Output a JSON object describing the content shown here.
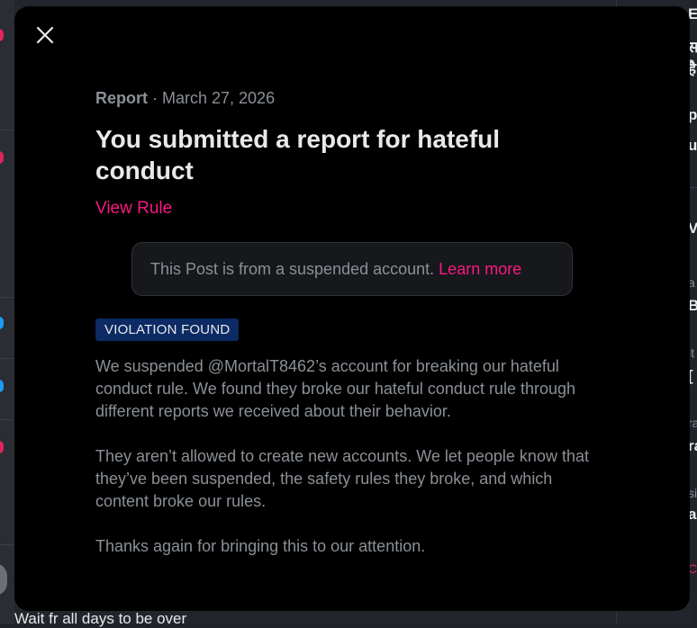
{
  "background": {
    "bottom_post_text": "Wait fr all days to be over",
    "right_glyphs": [
      "E",
      "स",
      "है",
      "p",
      "u",
      "V",
      "a",
      "B",
      "it",
      "[",
      "ra",
      "si",
      "al",
      "C"
    ]
  },
  "report": {
    "kind": "Report",
    "separator": " · ",
    "date": "March 27, 2026",
    "title": "You submitted a report for hateful conduct",
    "view_rule_label": "View Rule",
    "notice_text": "This Post is from a suspended account.",
    "learn_more_label": "Learn more",
    "badge_label": "VIOLATION FOUND",
    "paragraphs": [
      "We suspended @MortalT8462’s account for breaking our hateful conduct rule. We found they broke our hateful conduct rule through different reports we received about their behavior.",
      "They aren’t allowed to create new accounts. We let people know that they’ve been suspended, the safety rules they broke, and which content broke our rules.",
      "Thanks again for bringing this to our attention."
    ]
  },
  "colors": {
    "accent": "#f91880",
    "badge_bg": "#0c2a63",
    "modal_bg": "#000000",
    "muted_text": "#8b9096",
    "primary_text": "#e7e9ea"
  },
  "icons": {
    "close": "close-icon"
  }
}
